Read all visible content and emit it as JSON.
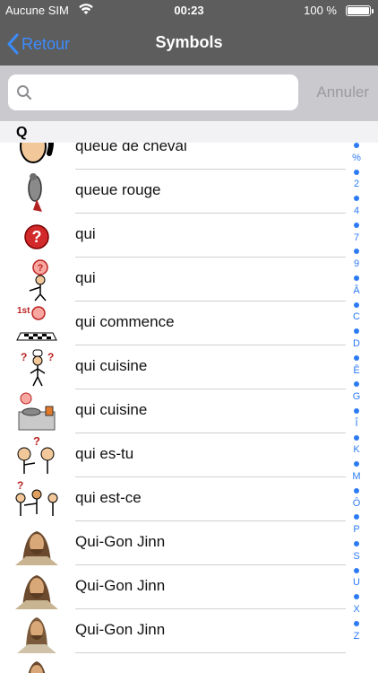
{
  "status": {
    "carrier": "Aucune SIM",
    "time": "00:23",
    "battery": "100 %"
  },
  "nav": {
    "back_label": "Retour",
    "title": "Symbols"
  },
  "search": {
    "value": "",
    "placeholder": "",
    "cancel_label": "Annuler"
  },
  "section": {
    "letter": "Q"
  },
  "rows": [
    {
      "label": "queue de cheval",
      "icon": "ponytail-face-icon"
    },
    {
      "label": "queue rouge",
      "icon": "redtail-bird-icon"
    },
    {
      "label": "qui",
      "icon": "question-mark-red-icon"
    },
    {
      "label": "qui",
      "icon": "person-asking-who-icon"
    },
    {
      "label": "qui commence",
      "icon": "who-starts-board-game-icon"
    },
    {
      "label": "qui cuisine",
      "icon": "who-cooks-person-icon"
    },
    {
      "label": "qui cuisine",
      "icon": "who-cooks-stove-icon"
    },
    {
      "label": "qui es-tu",
      "icon": "who-are-you-icon"
    },
    {
      "label": "qui est-ce",
      "icon": "who-is-it-icon"
    },
    {
      "label": "Qui-Gon Jinn",
      "icon": "qui-gon-jinn-portrait-icon"
    },
    {
      "label": "Qui-Gon Jinn",
      "icon": "qui-gon-jinn-portrait-icon"
    },
    {
      "label": "Qui-Gon Jinn",
      "icon": "qui-gon-jinn-portrait-icon"
    },
    {
      "label": "",
      "icon": "qui-gon-jinn-portrait-icon"
    }
  ],
  "index": {
    "items": [
      "•",
      "%",
      "•",
      "2",
      "•",
      "4",
      "•",
      "7",
      "•",
      "9",
      "•",
      "Â",
      "•",
      "C",
      "•",
      "D",
      "•",
      "Ê",
      "•",
      "G",
      "•",
      "Î",
      "•",
      "K",
      "•",
      "M",
      "•",
      "Ô",
      "•",
      "P",
      "•",
      "S",
      "•",
      "U",
      "•",
      "X",
      "•",
      "Z"
    ]
  },
  "colors": {
    "bar": "#5d5d5d",
    "accent": "#2c7bf6",
    "search_bg": "#c9c9ce"
  }
}
